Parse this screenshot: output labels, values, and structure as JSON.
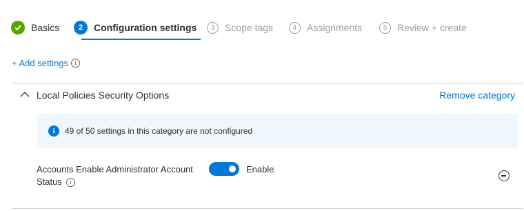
{
  "wizard": {
    "steps": [
      {
        "number": "",
        "label": "Basics",
        "state": "done"
      },
      {
        "number": "2",
        "label": "Configuration settings",
        "state": "current"
      },
      {
        "number": "3",
        "label": "Scope tags",
        "state": "future"
      },
      {
        "number": "4",
        "label": "Assignments",
        "state": "future"
      },
      {
        "number": "5",
        "label": "Review + create",
        "state": "future"
      }
    ]
  },
  "add_settings": {
    "label": "+ Add settings",
    "info_glyph": "i"
  },
  "category": {
    "title": "Local Policies Security Options",
    "remove_label": "Remove category",
    "expanded": true
  },
  "banner": {
    "info_glyph": "i",
    "text": "49 of 50 settings in this category are not configured"
  },
  "setting": {
    "name": "Accounts Enable Administrator Account Status",
    "info_glyph": "i",
    "toggle_on": true,
    "toggle_label": "Enable"
  },
  "colors": {
    "accent": "#0078d4",
    "success": "#57a300",
    "banner_bg": "#eff6fc",
    "muted": "#a19f9d"
  }
}
